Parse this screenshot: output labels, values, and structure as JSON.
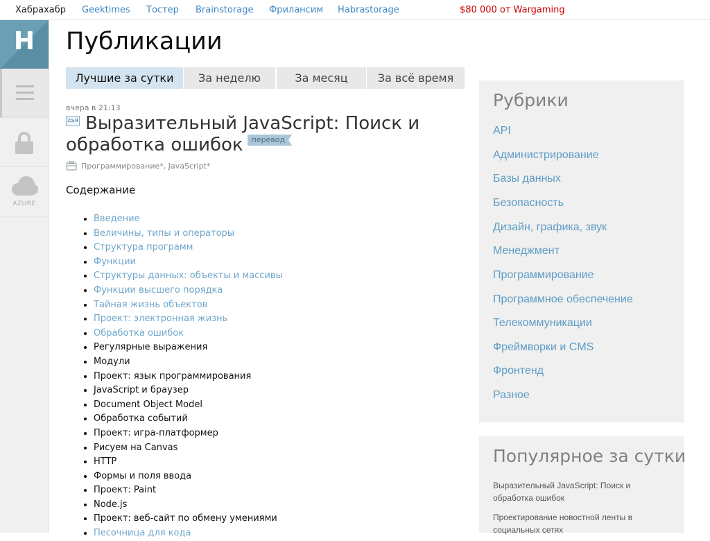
{
  "topnav": {
    "items": [
      "Хабрахабр",
      "Geektimes",
      "Тостер",
      "Brainstorage",
      "Фрилансим",
      "Habrastorage"
    ],
    "promo": "$80 000 от Wargaming",
    "link_color": "#3f87c5",
    "promo_color": "#cc0000"
  },
  "sidebar": {
    "logo_letter": "H",
    "logo_color": "#6a9fb5",
    "icons": [
      "menu-icon",
      "lock-icon",
      "cloud-icon"
    ],
    "azure_label": "AZURE"
  },
  "page": {
    "title": "Публикации",
    "tabs": [
      "Лучшие за сутки",
      "За неделю",
      "За месяц",
      "За всё время"
    ],
    "active_tab": "Лучшие за сутки"
  },
  "post": {
    "time": "вчера в 21:13",
    "flag_icon": "Z≥Я",
    "title": "Выразительный JavaScript: Поиск и обработка ошибок",
    "badge": "перевод",
    "hubs": "Программирование*, JavaScript*",
    "contents_heading": "Содержание",
    "toc": [
      {
        "text": "Введение",
        "link": true
      },
      {
        "text": "Величины, типы и операторы",
        "link": true
      },
      {
        "text": "Структура программ",
        "link": true
      },
      {
        "text": "Функции",
        "link": true
      },
      {
        "text": "Структуры данных: объекты и массивы",
        "link": true
      },
      {
        "text": "Функции высшего порядка",
        "link": true
      },
      {
        "text": "Тайная жизнь объектов",
        "link": true
      },
      {
        "text": "Проект: электронная жизнь",
        "link": true
      },
      {
        "text": "Обработка ошибок",
        "link": true
      },
      {
        "text": "Регулярные выражения",
        "link": false
      },
      {
        "text": "Модули",
        "link": false
      },
      {
        "text": "Проект: язык программирования",
        "link": false
      },
      {
        "text": "JavaScript и браузер",
        "link": false
      },
      {
        "text": "Document Object Model",
        "link": false
      },
      {
        "text": "Обработка событий",
        "link": false
      },
      {
        "text": "Проект: игра-платформер",
        "link": false
      },
      {
        "text": "Рисуем на Canvas",
        "link": false
      },
      {
        "text": "HTTP",
        "link": false
      },
      {
        "text": "Формы и поля ввода",
        "link": false
      },
      {
        "text": "Проект: Paint",
        "link": false
      },
      {
        "text": "Node.js",
        "link": false
      },
      {
        "text": "Проект: веб-сайт по обмену умениями",
        "link": false
      },
      {
        "text": "Песочница для кода",
        "link": true
      }
    ]
  },
  "rubrics": {
    "title": "Рубрики",
    "items": [
      "API",
      "Администрирование",
      "Базы данных",
      "Безопасность",
      "Дизайн, графика, звук",
      "Менеджмент",
      "Программирование",
      "Программное обеспечение",
      "Телекоммуникации",
      "Фреймворки и CMS",
      "Фронтенд",
      "Разное"
    ]
  },
  "popular": {
    "title": "Популярное за сутки",
    "items": [
      "Выразительный JavaScript: Поиск и обработка ошибок",
      "Проектирование новостной ленты в социальных сетях"
    ]
  }
}
